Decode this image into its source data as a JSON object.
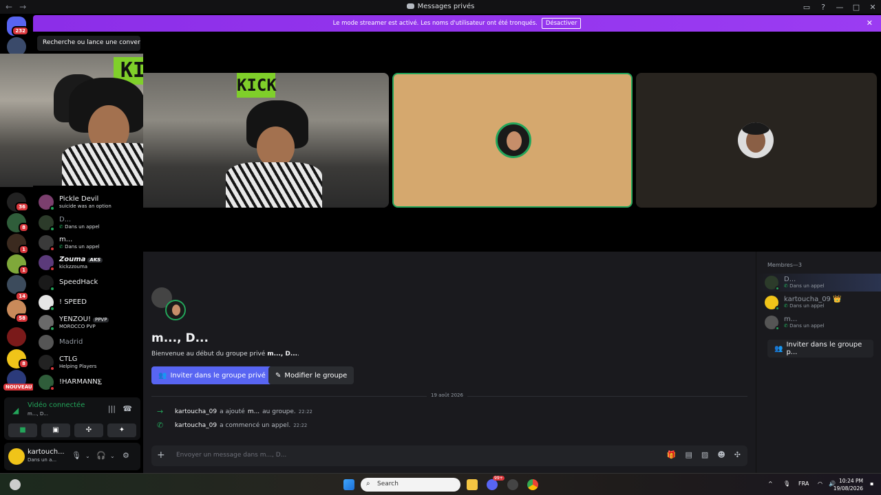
{
  "window": {
    "title": "Messages privés",
    "back": "←",
    "forward": "→",
    "title_icon": "discord-icon",
    "controls": [
      "inbox-icon",
      "help-icon",
      "minimize-icon",
      "maximize-icon",
      "close-icon"
    ]
  },
  "banner": {
    "text": "Le mode streamer est activé. Les noms d'utilisateur ont été tronqués.",
    "button": "Désactiver",
    "close": "✕",
    "color": "#9333ea"
  },
  "servers": {
    "home_badge": "232",
    "badges": [
      "36",
      "8",
      "1",
      "1",
      "14",
      "58",
      "8"
    ],
    "new_label": "NOUVEAU"
  },
  "search": {
    "placeholder": "Recherche ou lance une conver..."
  },
  "dms": [
    {
      "name": "Pickle Devil",
      "status": "suicide was an option",
      "online": "#23a55a"
    },
    {
      "name": "D...",
      "status": "Dans un appel",
      "online": "#23a55a",
      "in_call": true
    },
    {
      "name": "m...",
      "status": "Dans un appel",
      "online": "#da373c",
      "in_call": true
    },
    {
      "name": "Zouma",
      "tag": "AKS",
      "status": "kickzzouma",
      "online": "#da373c"
    },
    {
      "name": "SpeedHack",
      "status": "",
      "online": "#23a55a"
    },
    {
      "name": "! SPEED",
      "status": "",
      "online": "#23a55a"
    },
    {
      "name": "YENZOU!",
      "tag": "PPVP",
      "status": "MOROCCO PVP",
      "online": "#23a55a"
    },
    {
      "name": "Madrid",
      "status": "",
      "online": "#80848e"
    },
    {
      "name": "CTLG",
      "status": "Helping Players",
      "online": "#da373c"
    },
    {
      "name": "!HARMANN⨊",
      "status": "",
      "online": "#da373c"
    }
  ],
  "voice": {
    "label": "Vidéo connectée",
    "channel": "m..., D...",
    "icons": [
      "signal-icon",
      "soundboard-icon",
      "disconnect-icon",
      "camera-icon",
      "screen-share-icon",
      "activities-icon",
      "effects-icon"
    ]
  },
  "user": {
    "name": "kartouch...",
    "status": "Dans un a...",
    "icons": [
      "mic-icon",
      "headphones-icon",
      "settings-icon"
    ]
  },
  "group": {
    "title": "m..., D...",
    "intro_prefix": "Bienvenue au début du groupe privé ",
    "intro_names": "m..., D...",
    "intro_suffix": ".",
    "invite_button": "Inviter dans le groupe privé",
    "edit_button": "Modifier le groupe"
  },
  "messages": {
    "date": "19 août 2026",
    "items": [
      {
        "user": "kartoucha_09",
        "pre": "a ajouté",
        "target": "m...",
        "post": "au groupe.",
        "time": "22:22",
        "icon": "→"
      },
      {
        "user": "kartoucha_09",
        "pre": "a commencé un appel.",
        "target": "",
        "post": "",
        "time": "22:22",
        "icon": "✆"
      }
    ]
  },
  "composer": {
    "placeholder": "Envoyer un message dans m..., D..."
  },
  "members": {
    "header": "Membres—3",
    "list": [
      {
        "name": "D...",
        "status": "Dans un appel"
      },
      {
        "name": "kartoucha_09",
        "status": "Dans un appel",
        "crown": "👑"
      },
      {
        "name": "m...",
        "status": "Dans un appel"
      }
    ],
    "invite": "Inviter dans le groupe p..."
  },
  "taskbar": {
    "search": "Search",
    "lang": "FRA",
    "time": "10:24 PM",
    "date": "19/08/2026",
    "discord_badge": "99+"
  },
  "video": {
    "kick_text": "KICK"
  }
}
